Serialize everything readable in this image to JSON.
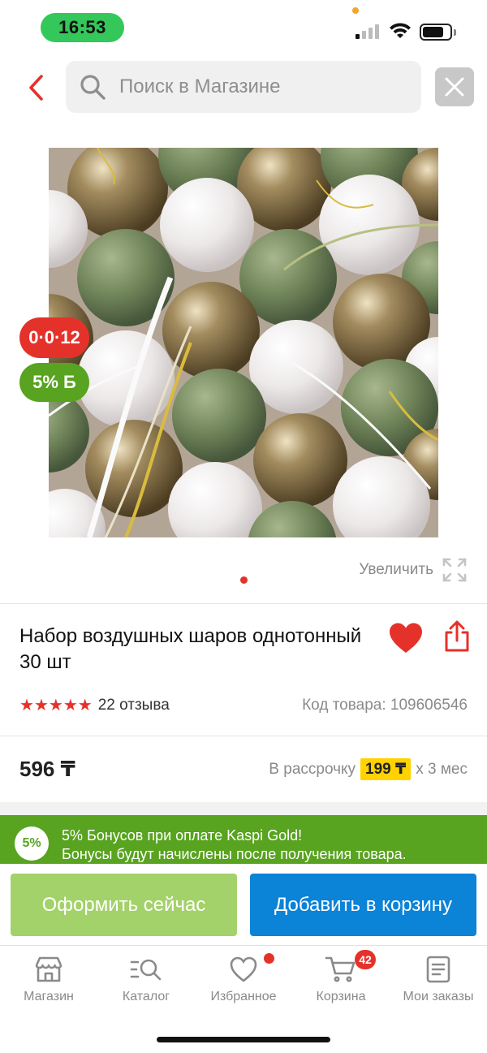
{
  "status_bar": {
    "time": "16:53"
  },
  "search": {
    "placeholder": "Поиск в Магазине",
    "value": ""
  },
  "product": {
    "timer_badge": "0·0·12",
    "bonus_badge": "5% Б",
    "zoom_label": "Увеличить",
    "title": "Набор воздушных шаров однотонный 30 шт",
    "rating_stars": 5,
    "reviews": "22 отзыва",
    "sku": "Код товара: 109606546",
    "price": "596 ₸",
    "installment_prefix": "В рассрочку",
    "installment_amount": "199 ₸",
    "installment_suffix": "х 3 мес"
  },
  "bonus_banner": {
    "circle": "5%",
    "line1": "5% Бонусов при оплате Kaspi Gold!",
    "line2": "Бонусы будут начислены после получения товара."
  },
  "actions": {
    "buy_now": "Оформить сейчас",
    "add_to_cart": "Добавить в корзину"
  },
  "tab_bar": {
    "items": [
      {
        "label": "Магазин",
        "icon": "store-icon"
      },
      {
        "label": "Каталог",
        "icon": "catalog-search-icon"
      },
      {
        "label": "Избранное",
        "icon": "heart-outline-icon"
      },
      {
        "label": "Корзина",
        "icon": "cart-icon"
      },
      {
        "label": "Мои заказы",
        "icon": "orders-list-icon"
      }
    ],
    "cart_count": "42"
  },
  "colors": {
    "accent_red": "#e4322b",
    "bonus_green": "#58a31f",
    "buy_now_green": "#a3d26a",
    "cart_blue": "#0b83d6",
    "installment_yellow": "#ffd200"
  }
}
